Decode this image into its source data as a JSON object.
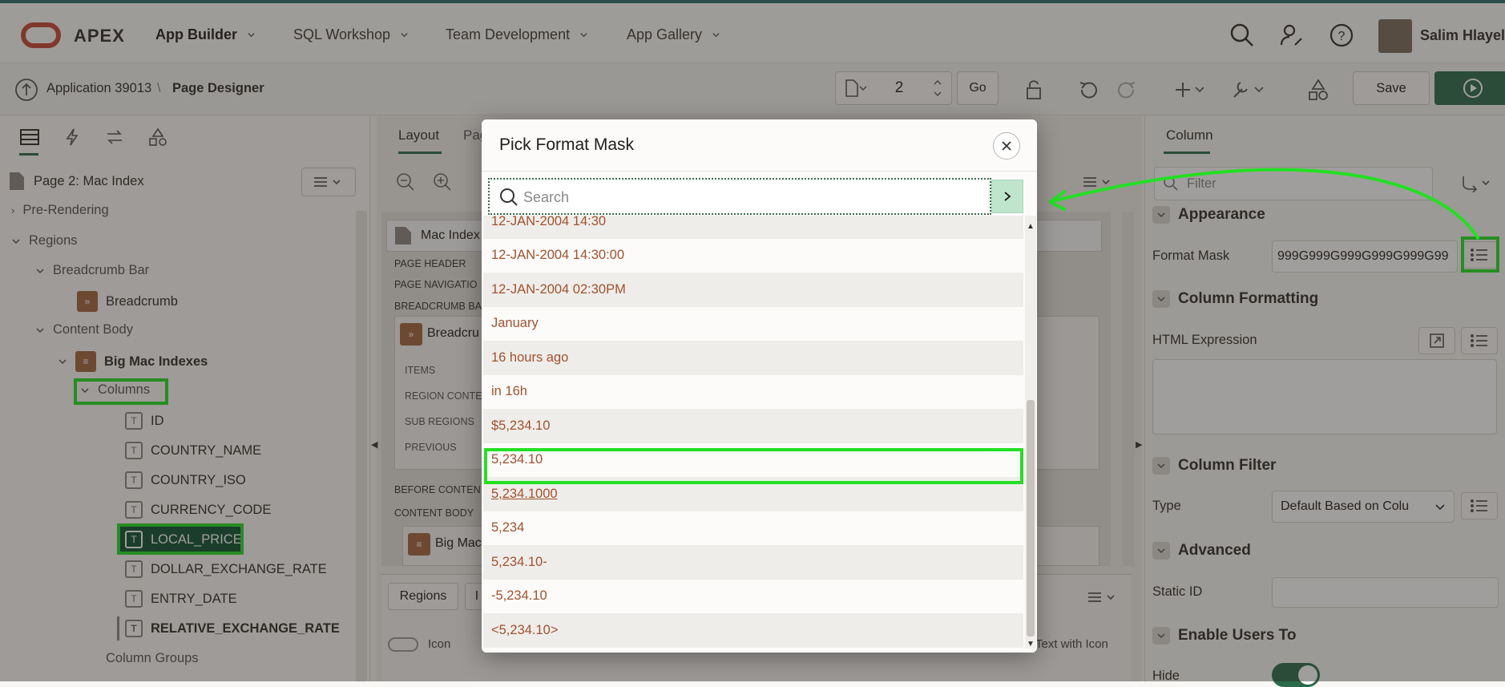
{
  "header": {
    "brand": "APEX",
    "nav": [
      {
        "label": "App Builder"
      },
      {
        "label": "SQL Workshop"
      },
      {
        "label": "Team Development"
      },
      {
        "label": "App Gallery"
      }
    ],
    "user_name": "Salim Hlayel"
  },
  "subbar": {
    "breadcrumb_app": "Application 39013",
    "breadcrumb_sep": "\\",
    "breadcrumb_page": "Page Designer",
    "page_number": "2",
    "go_label": "Go",
    "save_label": "Save"
  },
  "left_pane": {
    "page_title": "Page 2: Mac Index",
    "tree": {
      "pre_rendering": "Pre-Rendering",
      "regions": "Regions",
      "breadcrumb_bar": "Breadcrumb Bar",
      "breadcrumb": "Breadcrumb",
      "content_body": "Content Body",
      "big_mac_indexes": "Big Mac Indexes",
      "columns": "Columns",
      "column_items": [
        "ID",
        "COUNTRY_NAME",
        "COUNTRY_ISO",
        "CURRENCY_CODE",
        "LOCAL_PRICE",
        "DOLLAR_EXCHANGE_RATE",
        "ENTRY_DATE",
        "RELATIVE_EXCHANGE_RATE"
      ],
      "column_groups": "Column Groups"
    }
  },
  "middle_pane": {
    "tabs": [
      "Layout",
      "Pag"
    ],
    "region_title": "Mac Index",
    "labels": {
      "page_header": "PAGE HEADER",
      "page_navigation": "PAGE NAVIGATIO",
      "breadcrumb_bar": "BREADCRUMB BA",
      "breadcrumb_card": "Breadcru",
      "items": "ITEMS",
      "region_content": "REGION CONTE",
      "sub_regions": "SUB REGIONS",
      "previous": "PREVIOUS",
      "before_content": "BEFORE CONTEN",
      "content_body": "CONTENT BODY",
      "big_mac_card": "Big Mac I"
    },
    "bottom_tabs": [
      "Regions",
      "I"
    ],
    "legend": {
      "icon": "Icon",
      "text_with_icon": "Text with Icon"
    }
  },
  "right_pane": {
    "tab": "Column",
    "filter_placeholder": "Filter",
    "sections": {
      "appearance": "Appearance",
      "column_formatting": "Column Formatting",
      "column_filter": "Column Filter",
      "advanced": "Advanced",
      "enable_users_to": "Enable Users To"
    },
    "format_mask_label": "Format Mask",
    "format_mask_value": "999G999G999G999G999G99",
    "html_expression_label": "HTML Expression",
    "type_label": "Type",
    "type_value": "Default Based on Colu",
    "static_id_label": "Static ID",
    "hide_label": "Hide"
  },
  "dialog": {
    "title": "Pick Format Mask",
    "search_placeholder": "Search",
    "options": [
      "12-JAN-2004 14:30",
      "12-JAN-2004 14:30:00",
      "12-JAN-2004 02:30PM",
      "January",
      "16 hours ago",
      "in 16h",
      "$5,234.10",
      "5,234.10",
      "5,234.1000",
      "5,234",
      "5,234.10-",
      "-5,234.10",
      "<5,234.10>"
    ],
    "highlighted_option": "5,234.10"
  },
  "colors": {
    "accent_green": "#22e022",
    "run_button": "#2b6a4a",
    "option_text": "#a0522d",
    "oracle_red": "#c74634"
  }
}
